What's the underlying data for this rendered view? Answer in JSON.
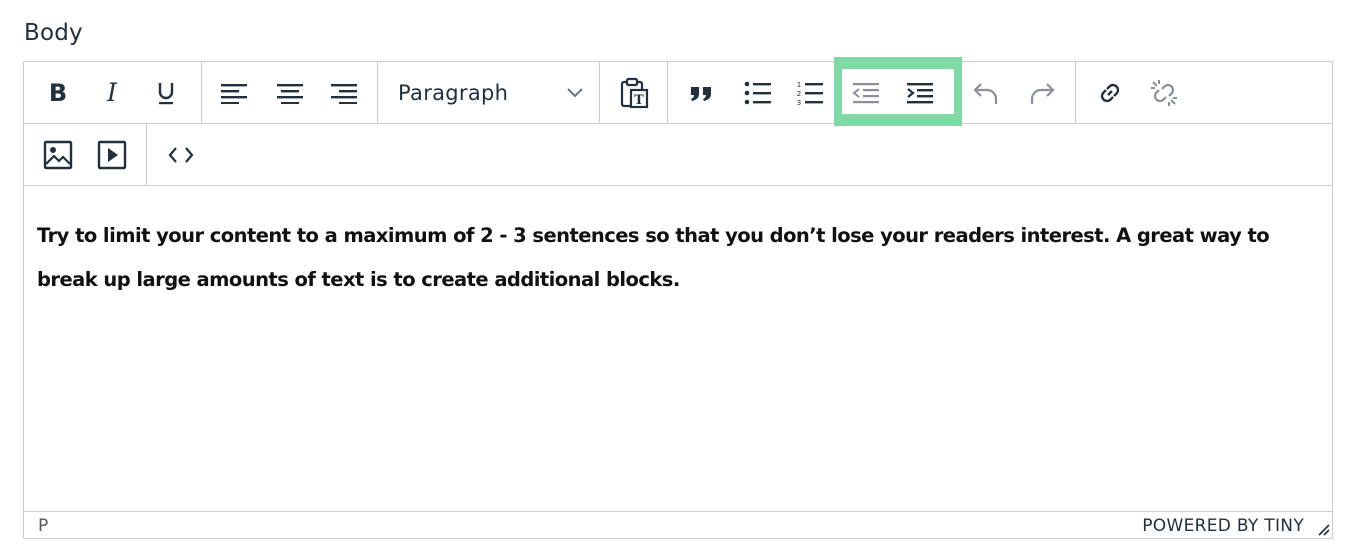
{
  "field": {
    "label": "Body"
  },
  "toolbar": {
    "block_format": {
      "selected": "Paragraph"
    }
  },
  "content": {
    "text": "Try to limit your content to a maximum of 2 - 3 sentences so that you don’t lose your readers interest. A great way to break up large amounts of text is to create additional blocks."
  },
  "statusbar": {
    "path": "P",
    "branding": "POWERED BY TINY"
  },
  "colors": {
    "highlight": "#7fd9a4",
    "icon": "#222f3e",
    "icon_disabled": "#8a9099"
  }
}
